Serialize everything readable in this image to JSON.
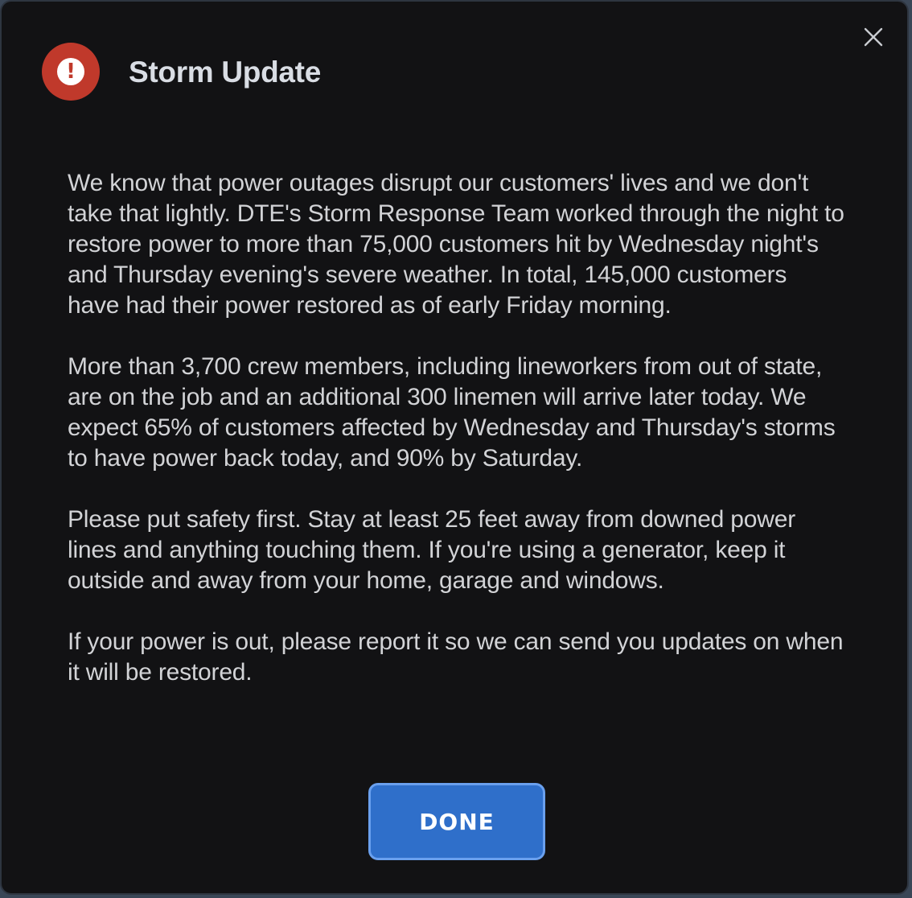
{
  "dialog": {
    "title": "Storm Update",
    "alert_icon": "exclamation-circle-icon",
    "alert_symbol": "!",
    "close_icon": "close-icon",
    "paragraphs": [
      "We know that power outages disrupt our customers' lives and we don't take that lightly. DTE's Storm Response Team worked through the night to restore power to more than 75,000 customers hit by Wednesday night's and Thursday evening's severe weather. In total, 145,000 customers have had their power restored as of early Friday morning.",
      "More than 3,700 crew members, including lineworkers from out of state, are on the job and an additional 300 linemen will arrive later today. We expect 65% of customers affected by Wednesday and Thursday's storms to have power back today, and 90% by Saturday.",
      "Please put safety first. Stay at least 25 feet away from downed power lines and anything touching them. If you're using a generator, keep it outside and away from your home, garage and windows.",
      "If your power is out, please report it so we can send you updates on when it will be restored."
    ],
    "done_label": "DONE"
  },
  "colors": {
    "dialog_background": "#121214",
    "alert_red": "#c0392b",
    "button_blue": "#2f6fca",
    "button_border": "#6aa0ee",
    "text": "#d2d3d6"
  }
}
